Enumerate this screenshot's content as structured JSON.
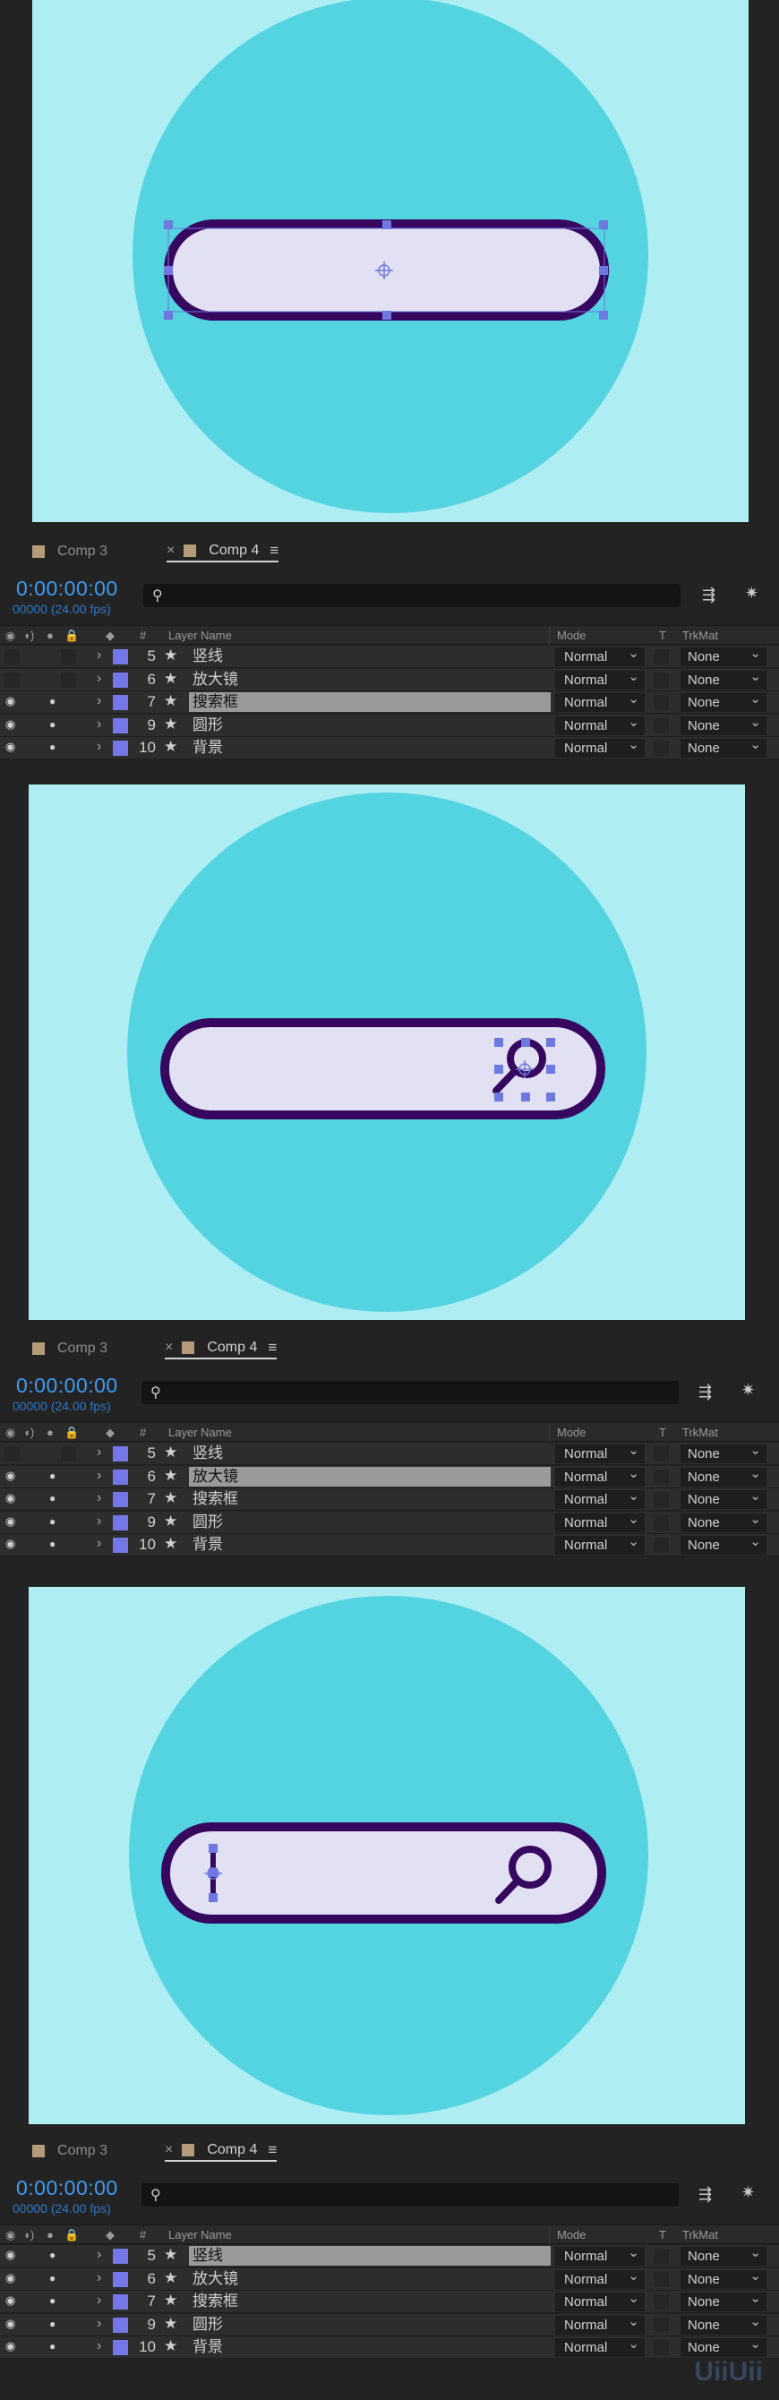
{
  "composition": {
    "background_color": "#aeeef3",
    "circle_color": "#54d3e0",
    "bar_fill": "#e2e1f3",
    "bar_stroke": "#36075f",
    "handle_color": "#6d78e0"
  },
  "panels": [
    {
      "tabs": [
        {
          "label": "Comp 3"
        },
        {
          "label": "Comp 4"
        }
      ],
      "close_glyph": "×",
      "menu_glyph": "≡",
      "timecode": "0:00:00:00",
      "frames": "00000 (24.00 fps)",
      "columns": {
        "hash": "#",
        "layer_name": "Layer Name",
        "mode": "Mode",
        "t": "T",
        "trkmat": "TrkMat"
      },
      "layers": [
        {
          "num": "5",
          "name": "竖线",
          "mode": "Normal",
          "trkmat": "None",
          "visible": false,
          "selected": false
        },
        {
          "num": "6",
          "name": "放大镜",
          "mode": "Normal",
          "trkmat": "None",
          "visible": false,
          "selected": false
        },
        {
          "num": "7",
          "name": "搜索框",
          "mode": "Normal",
          "trkmat": "None",
          "visible": true,
          "selected": true
        },
        {
          "num": "9",
          "name": "圆形",
          "mode": "Normal",
          "trkmat": "None",
          "visible": true,
          "selected": false
        },
        {
          "num": "10",
          "name": "背景",
          "mode": "Normal",
          "trkmat": "None",
          "visible": true,
          "selected": false
        }
      ]
    },
    {
      "tabs": [
        {
          "label": "Comp 3"
        },
        {
          "label": "Comp 4"
        }
      ],
      "close_glyph": "×",
      "menu_glyph": "≡",
      "timecode": "0:00:00:00",
      "frames": "00000 (24.00 fps)",
      "columns": {
        "hash": "#",
        "layer_name": "Layer Name",
        "mode": "Mode",
        "t": "T",
        "trkmat": "TrkMat"
      },
      "layers": [
        {
          "num": "5",
          "name": "竖线",
          "mode": "Normal",
          "trkmat": "None",
          "visible": false,
          "selected": false
        },
        {
          "num": "6",
          "name": "放大镜",
          "mode": "Normal",
          "trkmat": "None",
          "visible": true,
          "selected": true
        },
        {
          "num": "7",
          "name": "搜索框",
          "mode": "Normal",
          "trkmat": "None",
          "visible": true,
          "selected": false
        },
        {
          "num": "9",
          "name": "圆形",
          "mode": "Normal",
          "trkmat": "None",
          "visible": true,
          "selected": false
        },
        {
          "num": "10",
          "name": "背景",
          "mode": "Normal",
          "trkmat": "None",
          "visible": true,
          "selected": false
        }
      ]
    },
    {
      "tabs": [
        {
          "label": "Comp 3"
        },
        {
          "label": "Comp 4"
        }
      ],
      "close_glyph": "×",
      "menu_glyph": "≡",
      "timecode": "0:00:00:00",
      "frames": "00000 (24.00 fps)",
      "columns": {
        "hash": "#",
        "layer_name": "Layer Name",
        "mode": "Mode",
        "t": "T",
        "trkmat": "TrkMat"
      },
      "layers": [
        {
          "num": "5",
          "name": "竖线",
          "mode": "Normal",
          "trkmat": "None",
          "visible": true,
          "selected": true
        },
        {
          "num": "6",
          "name": "放大镜",
          "mode": "Normal",
          "trkmat": "None",
          "visible": true,
          "selected": false
        },
        {
          "num": "7",
          "name": "搜索框",
          "mode": "Normal",
          "trkmat": "None",
          "visible": true,
          "selected": false
        },
        {
          "num": "9",
          "name": "圆形",
          "mode": "Normal",
          "trkmat": "None",
          "visible": true,
          "selected": false
        },
        {
          "num": "10",
          "name": "背景",
          "mode": "Normal",
          "trkmat": "None",
          "visible": true,
          "selected": false
        }
      ]
    }
  ],
  "watermark": "UiiUii"
}
